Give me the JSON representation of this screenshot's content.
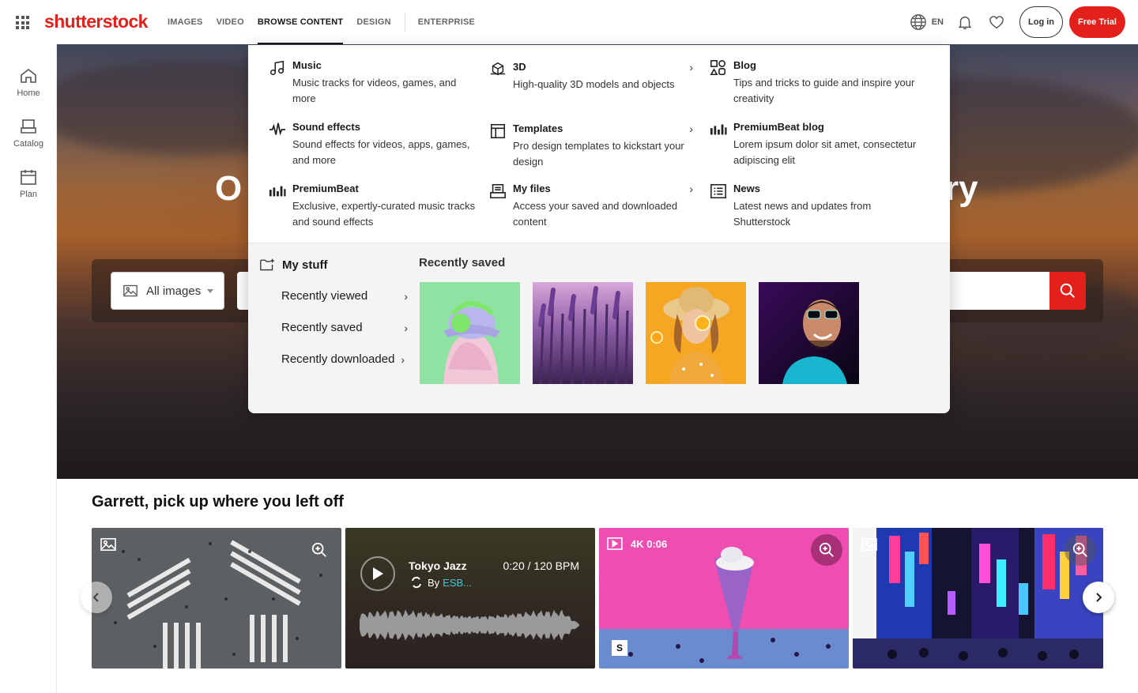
{
  "brand": {
    "logo_text": "shutterstock",
    "accent": "#e3201a"
  },
  "topnav": {
    "links": [
      "IMAGES",
      "VIDEO",
      "BROWSE CONTENT",
      "DESIGN",
      "ENTERPRISE"
    ],
    "active": "BROWSE CONTENT",
    "language": "EN",
    "login_label": "Log in",
    "trial_label": "Free Trial"
  },
  "rail": {
    "items": [
      {
        "label": "Home",
        "icon": "home-icon"
      },
      {
        "label": "Catalog",
        "icon": "catalog-icon"
      },
      {
        "label": "Plan",
        "icon": "calendar-icon"
      }
    ]
  },
  "hero": {
    "title_left": "O",
    "title_right": "ry",
    "search_type": "All images"
  },
  "menu": {
    "col1": [
      {
        "title": "Music",
        "desc": "Music tracks for videos, games, and more",
        "icon": "music-note-icon"
      },
      {
        "title": "Sound effects",
        "desc": "Sound effects for videos, apps, games, and more",
        "icon": "waveform-icon"
      },
      {
        "title": "PremiumBeat",
        "desc": "Exclusive, expertly-curated music tracks and sound effects",
        "icon": "premiumbeat-icon"
      }
    ],
    "col2": [
      {
        "title": "3D",
        "desc": "High-quality 3D models and objects",
        "icon": "3d-cube-icon"
      },
      {
        "title": "Templates",
        "desc": "Pro design templates to kickstart your design",
        "icon": "template-icon"
      },
      {
        "title": "My files",
        "desc": "Access your saved and downloaded content",
        "icon": "files-icon"
      }
    ],
    "col3": [
      {
        "title": "Blog",
        "desc": "Tips and tricks to guide and inspire your creativity",
        "icon": "blog-shapes-icon"
      },
      {
        "title": "PremiumBeat blog",
        "desc": "Lorem ipsum dolor sit amet, consectetur adipiscing elit",
        "icon": "premiumbeat-icon"
      },
      {
        "title": "News",
        "desc": "Latest news and updates from Shutterstock",
        "icon": "news-list-icon"
      }
    ],
    "mystuff": {
      "title": "My stuff",
      "links": [
        "Recently viewed",
        "Recently saved",
        "Recently downloaded"
      ]
    },
    "recently_saved": {
      "title": "Recently saved",
      "thumbs": [
        "woman-green-headphones",
        "lavender-field",
        "woman-orange-slice",
        "man-neon-glasses"
      ]
    }
  },
  "continue": {
    "title": "Garrett, pick up where you left off",
    "audio": {
      "track": "Tokyo Jazz",
      "meta": "0:20 / 120 BPM",
      "by": "By",
      "artist": "ESB..."
    },
    "video": {
      "badge": "4K 0:06",
      "s_badge": "S"
    }
  }
}
